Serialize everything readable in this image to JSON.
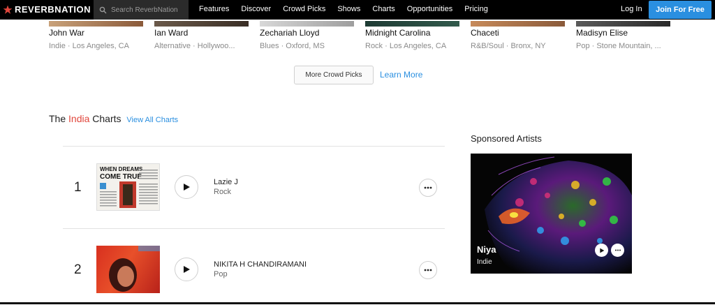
{
  "brand": {
    "name": "REVERBNATION",
    "accent": "#e1463c"
  },
  "search": {
    "placeholder": "Search ReverbNation",
    "icon": "search-icon"
  },
  "nav": {
    "items": [
      "Features",
      "Discover",
      "Crowd Picks",
      "Shows",
      "Charts",
      "Opportunities",
      "Pricing"
    ]
  },
  "account": {
    "login": "Log In",
    "join": "Join For Free",
    "join_color": "#2a8fe0"
  },
  "crowd_picks": {
    "artists": [
      {
        "name": "John War",
        "meta": "Indie · Los Angeles, CA"
      },
      {
        "name": "Ian Ward",
        "meta": "Alternative · Hollywoo..."
      },
      {
        "name": "Zechariah Lloyd",
        "meta": "Blues · Oxford, MS"
      },
      {
        "name": "Midnight Carolina",
        "meta": "Rock · Los Angeles, CA"
      },
      {
        "name": "Chaceti",
        "meta": "R&B/Soul · Bronx, NY"
      },
      {
        "name": "Madisyn Elise",
        "meta": "Pop · Stone Mountain, ..."
      }
    ],
    "more_button": "More Crowd Picks",
    "learn_more": "Learn More"
  },
  "charts": {
    "title_prefix": "The",
    "country": "India",
    "title_suffix": "Charts",
    "view_all": "View All Charts",
    "rows": [
      {
        "rank": "1",
        "name": "Lazie J",
        "genre": "Rock",
        "thumb_text_line1": "WHEN DREAMS",
        "thumb_text_line2": "COME TRUE"
      },
      {
        "rank": "2",
        "name": "NIKITA H CHANDIRAMANI",
        "genre": "Pop"
      }
    ]
  },
  "sponsored": {
    "title": "Sponsored Artists",
    "artist": "Niya",
    "genre": "Indie"
  }
}
